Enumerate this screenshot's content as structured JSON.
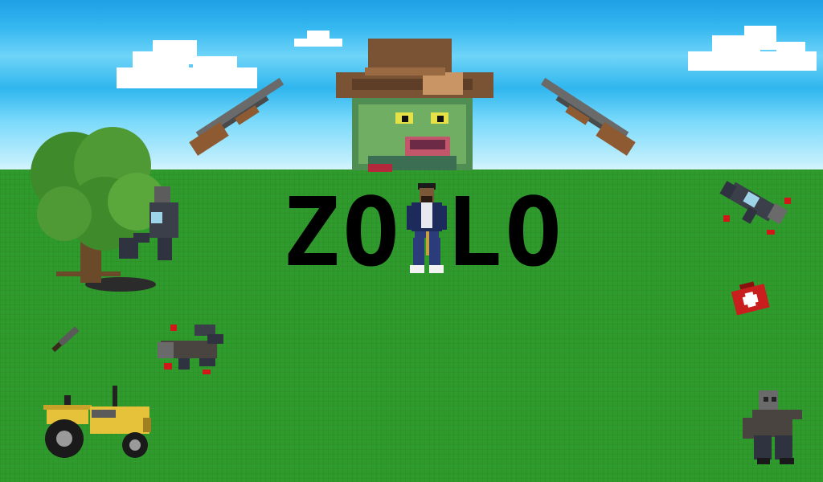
{
  "game": {
    "title_letters": [
      "Z",
      "O",
      "",
      "L",
      "O"
    ]
  },
  "colors": {
    "sky_top": "#1f9fe6",
    "sky_bottom": "#d6f6ff",
    "grass": "#2f9b2c",
    "title_text": "#000000"
  },
  "sprites": [
    "cowboy-zombie-head-icon",
    "shotgun-left-icon",
    "shotgun-right-icon",
    "tree-icon",
    "survivor-player-icon",
    "zombie-behind-tree-icon",
    "dead-zombie-left-icon",
    "dead-zombie-right-icon",
    "machete-icon",
    "medkit-icon",
    "tractor-icon",
    "walking-zombie-icon"
  ]
}
